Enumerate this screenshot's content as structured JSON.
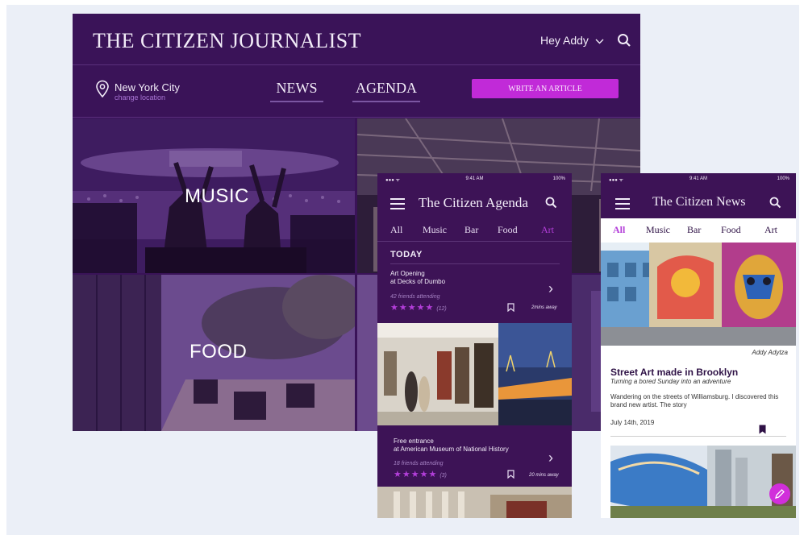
{
  "desktop": {
    "brand": "THE CITIZEN JOURNALIST",
    "greeting": "Hey Addy",
    "location": {
      "city": "New York City",
      "change_label": "change location"
    },
    "nav": {
      "news": "NEWS",
      "agenda": "AGENDA"
    },
    "write_button": "WRITE AN ARTICLE",
    "tiles": {
      "music": "MUSIC",
      "food": "FOOD"
    }
  },
  "agenda_app": {
    "status": {
      "time": "9:41 AM",
      "battery": "100%"
    },
    "title": "The Citizen Agenda",
    "categories": [
      "All",
      "Music",
      "Bar",
      "Food",
      "Art"
    ],
    "active_category": "Art",
    "section": "TODAY",
    "events": [
      {
        "title_line1": "Art Opening",
        "title_line2": "at Decks of Dumbo",
        "friends": "42 friends attending",
        "rating": 5,
        "rating_count": "(12)",
        "distance": "2mins away"
      },
      {
        "title_line1": "Free entrance",
        "title_line2": "at American Museum of National History",
        "friends": "18 friends attending",
        "rating": 5,
        "rating_count": "(3)",
        "distance": "20 mins away"
      }
    ]
  },
  "news_app": {
    "status": {
      "time": "9:41 AM",
      "battery": "100%"
    },
    "title": "The Citizen News",
    "categories": [
      "All",
      "Music",
      "Bar",
      "Food",
      "Art"
    ],
    "active_category": "All",
    "article": {
      "credit": "Addy Adytza",
      "title": "Street Art made in Brooklyn",
      "subtitle": "Turning a bored Sunday into an adventure",
      "body": "Wandering on the streets of Williamsburg. I discovered this brand new artist. The story",
      "date": "July 14th, 2019"
    }
  },
  "colors": {
    "brand_purple": "#3a1358",
    "accent": "#c12ad8",
    "active_tab": "#b33ed9"
  }
}
